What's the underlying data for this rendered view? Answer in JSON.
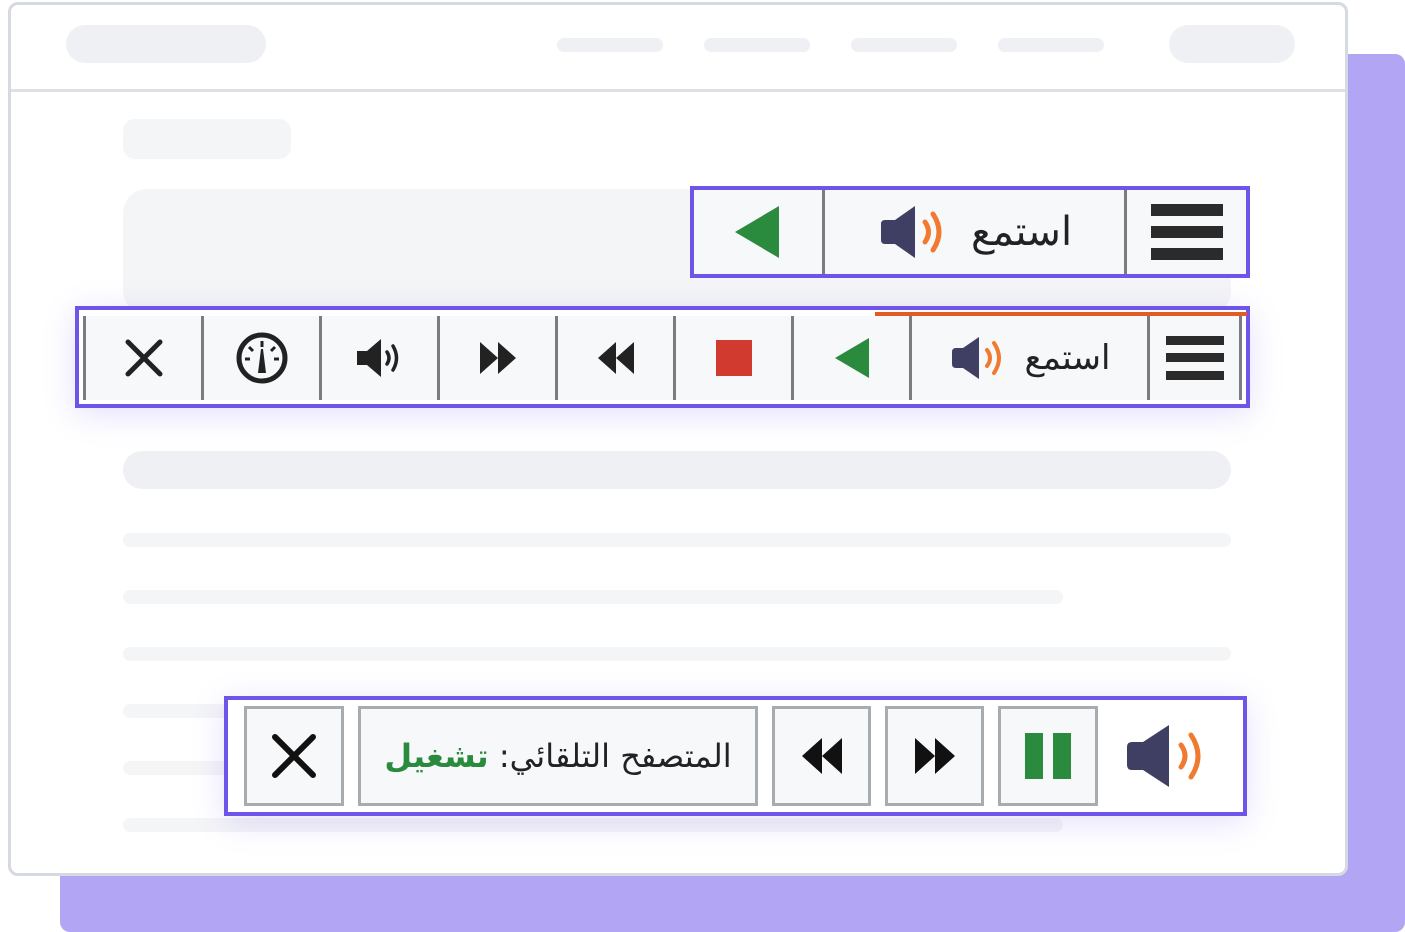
{
  "colors": {
    "accent_border": "#6e54e8",
    "backdrop": "#b2a6f4",
    "play_green": "#2a8a3e",
    "stop_red": "#d13b2f",
    "speaker_body": "#3f3f63",
    "speaker_waves": "#f07a2f",
    "progress": "#e35b24"
  },
  "compact_bar": {
    "listen_label": "استمع",
    "icons": [
      "menu-icon",
      "speaker-icon",
      "play-icon"
    ]
  },
  "expanded_bar": {
    "listen_label": "استمع",
    "icons": [
      "menu-icon",
      "speaker-icon",
      "play-icon",
      "stop-icon",
      "rewind-icon",
      "fast-forward-icon",
      "volume-icon",
      "speed-icon",
      "close-icon"
    ]
  },
  "autoplay_bar": {
    "label": "المتصفح التلقائي:",
    "state": "تشغيل",
    "icons": [
      "speaker-icon",
      "pause-icon",
      "fast-forward-icon",
      "rewind-icon",
      "close-icon"
    ]
  }
}
